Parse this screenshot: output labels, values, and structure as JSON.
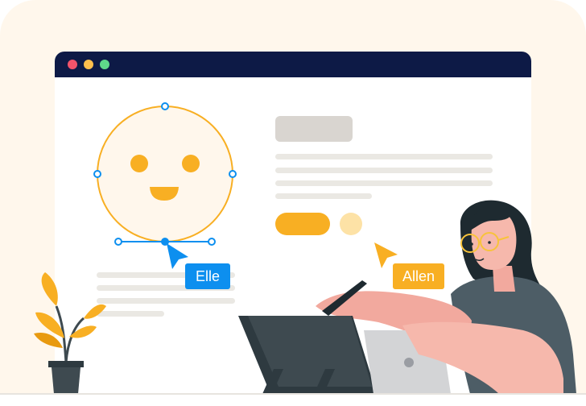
{
  "window": {
    "controls": {
      "close": "#F2546B",
      "minimize": "#FFC04D",
      "maximize": "#5FD88A"
    }
  },
  "cursors": {
    "elle": {
      "name": "Elle",
      "color": "#0D8FEF"
    },
    "allen": {
      "name": "Allen",
      "color": "#F8AF23"
    }
  },
  "colors": {
    "accent": "#F8AF23",
    "accent_light": "#FDE2A6",
    "selection_blue": "#0D8FEF",
    "titlebar": "#0D1A46",
    "background": "#FFF7EC",
    "placeholder_line": "#EAE8E3"
  },
  "icons": {
    "elle_cursor": "cursor-arrow-icon",
    "allen_cursor": "cursor-arrow-icon"
  }
}
